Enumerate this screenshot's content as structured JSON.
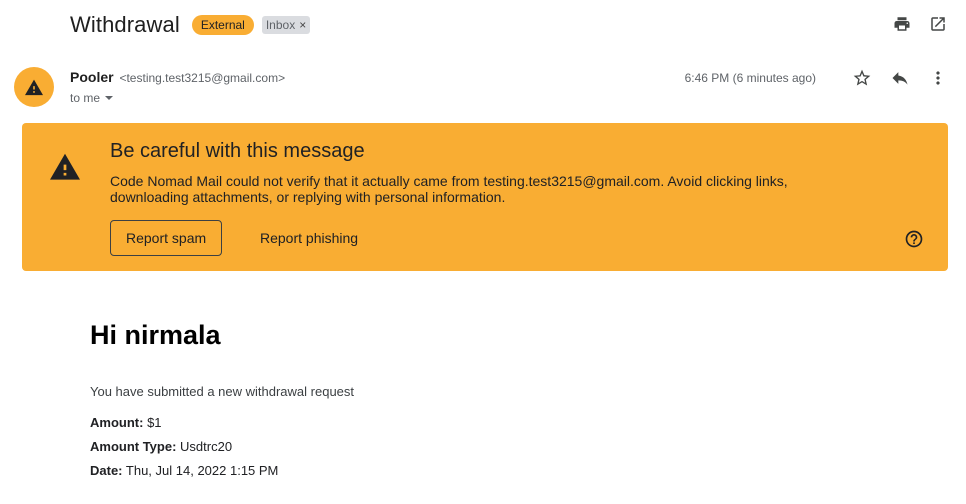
{
  "email": {
    "subject": "Withdrawal",
    "labels": {
      "external": "External",
      "inbox": "Inbox",
      "remove": "×"
    },
    "sender": {
      "name": "Pooler",
      "email": "<testing.test3215@gmail.com>",
      "recipient": "to me"
    },
    "timestamp": "6:46 PM (6 minutes ago)"
  },
  "warning": {
    "title": "Be careful with this message",
    "text": "Code Nomad Mail could not verify that it actually came from testing.test3215@gmail.com. Avoid clicking links, downloading attachments, or replying with personal information.",
    "report_spam": "Report spam",
    "report_phishing": "Report phishing"
  },
  "body": {
    "greeting": "Hi nirmala",
    "intro": "You have submitted a new withdrawal request",
    "fields": [
      {
        "label": "Amount:",
        "value": "$1"
      },
      {
        "label": "Amount Type:",
        "value": "Usdtrc20"
      },
      {
        "label": "Date:",
        "value": "Thu, Jul 14, 2022 1:15 PM"
      }
    ]
  },
  "icons": {
    "print": "print-icon",
    "open_new_window": "open-in-new-icon",
    "star": "star-icon",
    "reply": "reply-icon",
    "more": "more-vert-icon",
    "warning": "warning-icon",
    "help": "help-icon",
    "dropdown": "chevron-down-icon"
  },
  "colors": {
    "warning_banner": "#f9ad33",
    "external_badge": "#f9ad33",
    "inbox_badge": "#dadce0"
  }
}
